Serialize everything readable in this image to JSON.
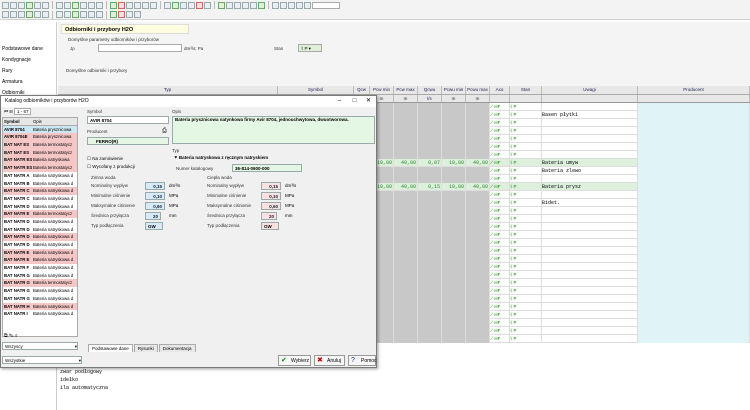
{
  "sidebar": {
    "items": [
      "Podstawowe dane",
      "Kondygnacje",
      "Rury",
      "Armatura",
      "Odbiorniki"
    ]
  },
  "form": {
    "title": "Odbiorniki i przybory H2O",
    "section_default": "Domyślne parametry odbiorników i przyborów",
    "jp_label": "Jp",
    "unit_label": "dm³/s; Pa",
    "stan_label": "Stan",
    "stan_value": "P",
    "section_other": "Domyślne odbiorniki i przybory"
  },
  "grid": {
    "headers": [
      "Typ",
      "Symbol",
      "Qcw",
      "Pcw min",
      "Pcw max",
      "Qcwu",
      "Pcwu min",
      "Pcwu max",
      "Axo",
      "Stan",
      "Uwagi",
      "Producent"
    ],
    "units": [
      "",
      "",
      "",
      "m",
      "m",
      "l/s",
      "m",
      "m",
      "",
      "",
      "",
      ""
    ],
    "row_values": [
      {
        "qcw": "",
        "p1": "",
        "p2": "",
        "q2": "",
        "p3": "",
        "p4": "",
        "uwagi": "",
        "prod": ""
      },
      {
        "qcw": "",
        "p1": "",
        "p2": "",
        "q2": "",
        "p3": "",
        "p4": "",
        "uwagi": "Basen płytki",
        "prod": ""
      },
      {
        "qcw": "",
        "p1": "",
        "p2": "",
        "q2": "",
        "p3": "",
        "p4": "",
        "uwagi": "",
        "prod": ""
      },
      {
        "qcw": "",
        "p1": "",
        "p2": "",
        "q2": "",
        "p3": "",
        "p4": "",
        "uwagi": "",
        "prod": ""
      },
      {
        "qcw": "",
        "p1": "",
        "p2": "",
        "q2": "",
        "p3": "",
        "p4": "",
        "uwagi": "",
        "prod": ""
      },
      {
        "qcw": "",
        "p1": "",
        "p2": "",
        "q2": "",
        "p3": "",
        "p4": "",
        "uwagi": "",
        "prod": ""
      },
      {
        "qcw": "",
        "p1": "",
        "p2": "",
        "q2": "",
        "p3": "",
        "p4": "",
        "uwagi": "",
        "prod": ""
      },
      {
        "qcw": "",
        "p1": "10,00",
        "p2": "40,00",
        "q2": "0,07",
        "p3": "10,00",
        "p4": "40,00",
        "uwagi": "Bateria umyw",
        "prod": ""
      },
      {
        "qcw": "",
        "p1": "",
        "p2": "",
        "q2": "",
        "p3": "",
        "p4": "",
        "uwagi": "Bateria zlewo",
        "prod": ""
      },
      {
        "qcw": "",
        "p1": "",
        "p2": "",
        "q2": "",
        "p3": "",
        "p4": "",
        "uwagi": "",
        "prod": ""
      },
      {
        "qcw": "",
        "p1": "10,00",
        "p2": "40,00",
        "q2": "0,15",
        "p3": "10,00",
        "p4": "40,00",
        "uwagi": "Bateria prysz",
        "prod": ""
      },
      {
        "qcw": "",
        "p1": "",
        "p2": "",
        "q2": "",
        "p3": "",
        "p4": "",
        "uwagi": "",
        "prod": ""
      },
      {
        "qcw": "",
        "p1": "",
        "p2": "",
        "q2": "",
        "p3": "",
        "p4": "",
        "uwagi": "Bidet.",
        "prod": ""
      }
    ],
    "axo_label": "HF",
    "stan_label": "P",
    "bottom_rows": [
      "zwar podłogowy",
      "idełko",
      "ila automatyczna"
    ]
  },
  "dialog": {
    "title": "Katalog odbiorników i przyborów H2O",
    "list_header_symbol": "Symbol",
    "list_header_opis": "Opis",
    "page_label": "1 - 67",
    "list": [
      {
        "s": "AVIR 8704",
        "o": "Bateria prysznicowa"
      },
      {
        "s": "AVIR 8704E",
        "o": "Bateria prysznicowa"
      },
      {
        "s": "BAT NAT ES",
        "o": "Bateria termostatycz"
      },
      {
        "s": "BAT NAT ES",
        "o": "Bateria termostatycz"
      },
      {
        "s": "BAT NATR ES",
        "o": "Bateria natryskowa"
      },
      {
        "s": "BAT NATR ES",
        "o": "Bateria termostatycz"
      },
      {
        "s": "BAT NATR A",
        "o": "Bateria natryskowa d"
      },
      {
        "s": "BAT NATR B",
        "o": "Bateria natryskowa d"
      },
      {
        "s": "BAT NATR C",
        "o": "Bateria natryskowa d"
      },
      {
        "s": "BAT NATR C",
        "o": "Bateria natryskowa d"
      },
      {
        "s": "BAT NATR D",
        "o": "Bateria natryskowa d"
      },
      {
        "s": "BAT NATR E",
        "o": "Bateria termostatycz"
      },
      {
        "s": "BAT NATR D",
        "o": "Bateria natryskowa d"
      },
      {
        "s": "BAT NATR D",
        "o": "Bateria natryskowa d"
      },
      {
        "s": "BAT NATR D",
        "o": "Bateria natryskowa d"
      },
      {
        "s": "BAT NATR D",
        "o": "Bateria natryskowa d"
      },
      {
        "s": "BAT NATR E",
        "o": "Bateria natryskowa d"
      },
      {
        "s": "BAT NATR E",
        "o": "Bateria natryskowa d"
      },
      {
        "s": "BAT NATR F",
        "o": "Bateria natryskowa d"
      },
      {
        "s": "BAT NATR G",
        "o": "Bateria natryskowa d"
      },
      {
        "s": "BAT NATR G",
        "o": "Bateria termostatycz"
      },
      {
        "s": "BAT NATR G",
        "o": "Bateria natryskowa d"
      },
      {
        "s": "BAT NATR G",
        "o": "Bateria natryskowa d"
      },
      {
        "s": "BAT NATR H",
        "o": "Bateria natryskowa d"
      },
      {
        "s": "BAT NATR I",
        "o": "Bateria natryskowa d"
      }
    ],
    "symbol_label": "Symbol",
    "symbol_value": "AVIR 8704",
    "opis_label": "Opis",
    "opis_value": "Bateria prysznicowa natynkowa firmy Avir 8704, jednouchwytowa, dwuotworowa.",
    "producent_label": "Producent",
    "producent_value": "FERRO(R)",
    "na_zamowienie": "Na zamówienie",
    "wycofany": "Wycofany z produkcji",
    "typ_label": "Typ",
    "typ_value": "Bateria natryskowa z ręcznym natryskiem",
    "numer_label": "Numer katalogowy",
    "numer_value": "36-814-0600-000",
    "zimna_woda": "Zimna woda",
    "ciepla_woda": "Ciepła woda",
    "z_labels": [
      "Nominalny wypływ",
      "Minimalne ciśnienie",
      "Maksymalne ciśnienie",
      "Średnica przyłącza",
      "Typ podłączenia"
    ],
    "z_values": [
      "0,15",
      "0,10",
      "0,60",
      "20",
      "GW"
    ],
    "c_values": [
      "0,15",
      "0,10",
      "0,60",
      "20",
      "GW"
    ],
    "z_units": [
      "dm³/s",
      "MPa",
      "MPa",
      "mm",
      ""
    ],
    "tabs": [
      "Podstawowe dane",
      "Rysunki",
      "Dokumentacja"
    ],
    "wszyscy": "Wszyscy",
    "wszystkie": "Wszystkie",
    "btn_wybierz": "Wybierz",
    "btn_anuluj": "Anuluj",
    "btn_pomoc": "Pomoc"
  }
}
